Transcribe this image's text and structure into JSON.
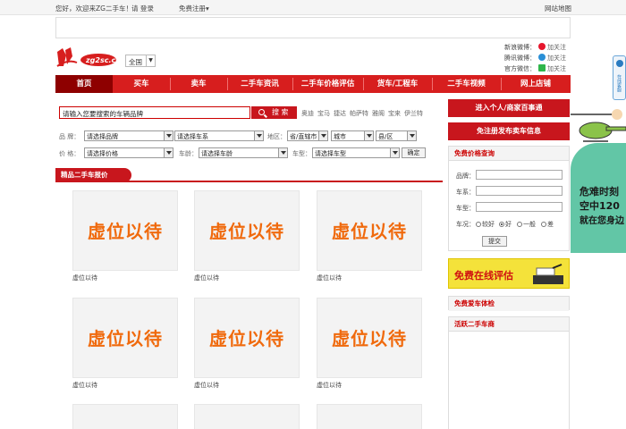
{
  "topbar": {
    "greeting": "您好，欢迎来ZG二手车！",
    "login_prompt": "请 登录",
    "register": "免费注册▾",
    "sitemap": "网站地图"
  },
  "header": {
    "logo_text": "ZG二手车",
    "region": "全国",
    "social": [
      {
        "platform": "新浪微博：",
        "action": "加关注",
        "icon": "weibo-icon",
        "color": "#e6162d"
      },
      {
        "platform": "腾讯微博：",
        "action": "加关注",
        "icon": "tencent-weibo-icon",
        "color": "#2a8fd6"
      },
      {
        "platform": "官方微信：",
        "action": "加关注",
        "icon": "wechat-icon",
        "color": "#2fb64b"
      }
    ]
  },
  "nav": {
    "items": [
      "首页",
      "买车",
      "卖车",
      "二手车资讯",
      "二手车价格评估",
      "货车/工程车",
      "二手车视频",
      "网上店铺"
    ],
    "active_index": 0
  },
  "search": {
    "placeholder": "请输入您要搜索的车辆品牌",
    "button": "搜 索",
    "hot_brands": [
      "奥迪",
      "宝马",
      "捷达",
      "帕萨特",
      "雅阁",
      "宝来",
      "伊兰特"
    ]
  },
  "filters": {
    "brand_label": "品 牌：",
    "brand_value": "请选择品牌",
    "series_value": "请选择车系",
    "region_label": "地区：",
    "province_value": "省/直辖市",
    "city_value": "城市",
    "county_value": "县/区",
    "price_label": "价 格：",
    "price_value": "请选择价格",
    "age_label": "车龄：",
    "age_value": "请选择车龄",
    "type_label": "车型：",
    "type_value": "请选择车型",
    "confirm": "确定"
  },
  "listing": {
    "section_title": "精品二手车报价",
    "cards": [
      {
        "placeholder": "虚位以待",
        "caption": "虚位以待"
      },
      {
        "placeholder": "虚位以待",
        "caption": "虚位以待"
      },
      {
        "placeholder": "虚位以待",
        "caption": "虚位以待"
      },
      {
        "placeholder": "虚位以待",
        "caption": "虚位以待"
      },
      {
        "placeholder": "虚位以待",
        "caption": "虚位以待"
      },
      {
        "placeholder": "虚位以待",
        "caption": "虚位以待"
      }
    ]
  },
  "sidebar": {
    "btn_merchant": "进入个人/商家百事通",
    "btn_publish": "免注册发布卖车信息",
    "price_query": {
      "title": "免费价格查询",
      "brand_label": "品牌：",
      "series_label": "车系：",
      "type_label": "车型：",
      "condition_label": "车况：",
      "conditions": [
        "较好",
        "好",
        "一般",
        "差"
      ],
      "selected_condition": "好",
      "submit": "提交"
    },
    "eval_banner": "免费在线评估",
    "inspection_title": "免费爱车体检",
    "active_dealers_title": "活跃二手车商"
  },
  "float_ad": {
    "lines": [
      "危难时刻",
      "空中120",
      "就在您身边"
    ],
    "side_tab": "在线客服"
  }
}
